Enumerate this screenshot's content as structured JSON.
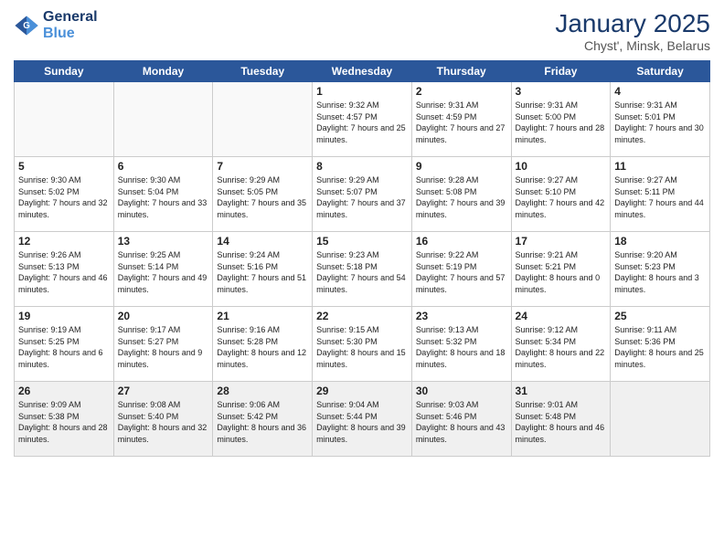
{
  "logo": {
    "line1": "General",
    "line2": "Blue"
  },
  "title": "January 2025",
  "subtitle": "Chyst', Minsk, Belarus",
  "weekdays": [
    "Sunday",
    "Monday",
    "Tuesday",
    "Wednesday",
    "Thursday",
    "Friday",
    "Saturday"
  ],
  "weeks": [
    [
      {
        "day": "",
        "sunrise": "",
        "sunset": "",
        "daylight": ""
      },
      {
        "day": "",
        "sunrise": "",
        "sunset": "",
        "daylight": ""
      },
      {
        "day": "",
        "sunrise": "",
        "sunset": "",
        "daylight": ""
      },
      {
        "day": "1",
        "sunrise": "Sunrise: 9:32 AM",
        "sunset": "Sunset: 4:57 PM",
        "daylight": "Daylight: 7 hours and 25 minutes."
      },
      {
        "day": "2",
        "sunrise": "Sunrise: 9:31 AM",
        "sunset": "Sunset: 4:59 PM",
        "daylight": "Daylight: 7 hours and 27 minutes."
      },
      {
        "day": "3",
        "sunrise": "Sunrise: 9:31 AM",
        "sunset": "Sunset: 5:00 PM",
        "daylight": "Daylight: 7 hours and 28 minutes."
      },
      {
        "day": "4",
        "sunrise": "Sunrise: 9:31 AM",
        "sunset": "Sunset: 5:01 PM",
        "daylight": "Daylight: 7 hours and 30 minutes."
      }
    ],
    [
      {
        "day": "5",
        "sunrise": "Sunrise: 9:30 AM",
        "sunset": "Sunset: 5:02 PM",
        "daylight": "Daylight: 7 hours and 32 minutes."
      },
      {
        "day": "6",
        "sunrise": "Sunrise: 9:30 AM",
        "sunset": "Sunset: 5:04 PM",
        "daylight": "Daylight: 7 hours and 33 minutes."
      },
      {
        "day": "7",
        "sunrise": "Sunrise: 9:29 AM",
        "sunset": "Sunset: 5:05 PM",
        "daylight": "Daylight: 7 hours and 35 minutes."
      },
      {
        "day": "8",
        "sunrise": "Sunrise: 9:29 AM",
        "sunset": "Sunset: 5:07 PM",
        "daylight": "Daylight: 7 hours and 37 minutes."
      },
      {
        "day": "9",
        "sunrise": "Sunrise: 9:28 AM",
        "sunset": "Sunset: 5:08 PM",
        "daylight": "Daylight: 7 hours and 39 minutes."
      },
      {
        "day": "10",
        "sunrise": "Sunrise: 9:27 AM",
        "sunset": "Sunset: 5:10 PM",
        "daylight": "Daylight: 7 hours and 42 minutes."
      },
      {
        "day": "11",
        "sunrise": "Sunrise: 9:27 AM",
        "sunset": "Sunset: 5:11 PM",
        "daylight": "Daylight: 7 hours and 44 minutes."
      }
    ],
    [
      {
        "day": "12",
        "sunrise": "Sunrise: 9:26 AM",
        "sunset": "Sunset: 5:13 PM",
        "daylight": "Daylight: 7 hours and 46 minutes."
      },
      {
        "day": "13",
        "sunrise": "Sunrise: 9:25 AM",
        "sunset": "Sunset: 5:14 PM",
        "daylight": "Daylight: 7 hours and 49 minutes."
      },
      {
        "day": "14",
        "sunrise": "Sunrise: 9:24 AM",
        "sunset": "Sunset: 5:16 PM",
        "daylight": "Daylight: 7 hours and 51 minutes."
      },
      {
        "day": "15",
        "sunrise": "Sunrise: 9:23 AM",
        "sunset": "Sunset: 5:18 PM",
        "daylight": "Daylight: 7 hours and 54 minutes."
      },
      {
        "day": "16",
        "sunrise": "Sunrise: 9:22 AM",
        "sunset": "Sunset: 5:19 PM",
        "daylight": "Daylight: 7 hours and 57 minutes."
      },
      {
        "day": "17",
        "sunrise": "Sunrise: 9:21 AM",
        "sunset": "Sunset: 5:21 PM",
        "daylight": "Daylight: 8 hours and 0 minutes."
      },
      {
        "day": "18",
        "sunrise": "Sunrise: 9:20 AM",
        "sunset": "Sunset: 5:23 PM",
        "daylight": "Daylight: 8 hours and 3 minutes."
      }
    ],
    [
      {
        "day": "19",
        "sunrise": "Sunrise: 9:19 AM",
        "sunset": "Sunset: 5:25 PM",
        "daylight": "Daylight: 8 hours and 6 minutes."
      },
      {
        "day": "20",
        "sunrise": "Sunrise: 9:17 AM",
        "sunset": "Sunset: 5:27 PM",
        "daylight": "Daylight: 8 hours and 9 minutes."
      },
      {
        "day": "21",
        "sunrise": "Sunrise: 9:16 AM",
        "sunset": "Sunset: 5:28 PM",
        "daylight": "Daylight: 8 hours and 12 minutes."
      },
      {
        "day": "22",
        "sunrise": "Sunrise: 9:15 AM",
        "sunset": "Sunset: 5:30 PM",
        "daylight": "Daylight: 8 hours and 15 minutes."
      },
      {
        "day": "23",
        "sunrise": "Sunrise: 9:13 AM",
        "sunset": "Sunset: 5:32 PM",
        "daylight": "Daylight: 8 hours and 18 minutes."
      },
      {
        "day": "24",
        "sunrise": "Sunrise: 9:12 AM",
        "sunset": "Sunset: 5:34 PM",
        "daylight": "Daylight: 8 hours and 22 minutes."
      },
      {
        "day": "25",
        "sunrise": "Sunrise: 9:11 AM",
        "sunset": "Sunset: 5:36 PM",
        "daylight": "Daylight: 8 hours and 25 minutes."
      }
    ],
    [
      {
        "day": "26",
        "sunrise": "Sunrise: 9:09 AM",
        "sunset": "Sunset: 5:38 PM",
        "daylight": "Daylight: 8 hours and 28 minutes."
      },
      {
        "day": "27",
        "sunrise": "Sunrise: 9:08 AM",
        "sunset": "Sunset: 5:40 PM",
        "daylight": "Daylight: 8 hours and 32 minutes."
      },
      {
        "day": "28",
        "sunrise": "Sunrise: 9:06 AM",
        "sunset": "Sunset: 5:42 PM",
        "daylight": "Daylight: 8 hours and 36 minutes."
      },
      {
        "day": "29",
        "sunrise": "Sunrise: 9:04 AM",
        "sunset": "Sunset: 5:44 PM",
        "daylight": "Daylight: 8 hours and 39 minutes."
      },
      {
        "day": "30",
        "sunrise": "Sunrise: 9:03 AM",
        "sunset": "Sunset: 5:46 PM",
        "daylight": "Daylight: 8 hours and 43 minutes."
      },
      {
        "day": "31",
        "sunrise": "Sunrise: 9:01 AM",
        "sunset": "Sunset: 5:48 PM",
        "daylight": "Daylight: 8 hours and 46 minutes."
      },
      {
        "day": "",
        "sunrise": "",
        "sunset": "",
        "daylight": ""
      }
    ]
  ]
}
